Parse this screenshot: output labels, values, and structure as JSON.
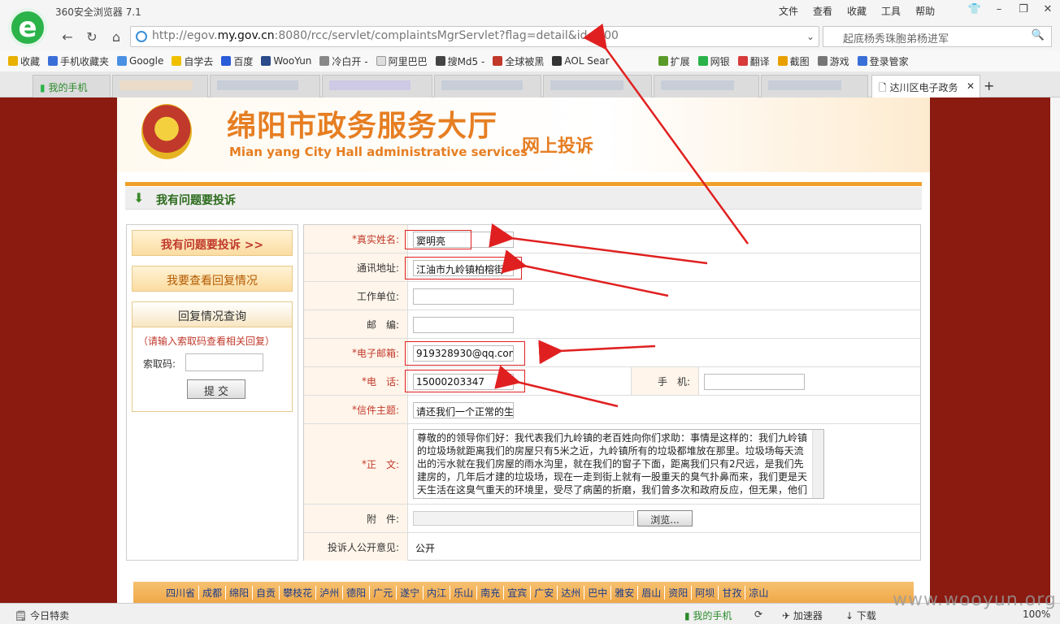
{
  "browser": {
    "title": "360安全浏览器 7.1",
    "menu": [
      "文件",
      "查看",
      "收藏",
      "工具",
      "帮助"
    ],
    "url_prefix": "http://egov.",
    "url_domain": "my.gov.cn",
    "url_suffix": ":8080/rcc/servlet/complaintsMgrServlet?flag=detail&id=800",
    "search_text": "起底杨秀珠胞弟杨进军",
    "bookmarks": [
      "收藏",
      "手机收藏夹",
      "Google",
      "自学去",
      "百度",
      "WooYun",
      "冷白开 -",
      "阿里巴巴",
      "搜Md5 -",
      "全球被黑",
      "AOL Sear",
      "扩展",
      "网银",
      "翻译",
      "截图",
      "游戏",
      "登录管家"
    ],
    "tabs": [
      "我的手机",
      "达川区电子政务"
    ],
    "status_left": "今日特卖",
    "status_items": [
      "我的手机",
      "加速器",
      "下载"
    ],
    "zoom": "100%",
    "watermark": "www.wooyun.org"
  },
  "site": {
    "title_cn": "绵阳市政务服务大厅",
    "title_en": "Mian yang City Hall administrative services",
    "subtitle": "网上投诉",
    "section": "我有问题要投诉"
  },
  "sidebar": {
    "btn1": "我有问题要投诉 >>",
    "btn2": "我要查看回复情况",
    "btn3": "回复情况查询",
    "hint": "（请输入索取码查看相关回复）",
    "code_label": "索取码:",
    "submit": "提 交"
  },
  "form": {
    "name_label": "真实姓名:",
    "name_value": "窦明亮",
    "address_label": "通讯地址:",
    "address_value": "江油市九岭镇柏榕街",
    "work_label": "工作单位:",
    "postcode_label": "邮　编:",
    "email_label": "电子邮箱:",
    "email_value": "919328930@qq.com",
    "phone_label": "电　话:",
    "phone_value": "15000203347",
    "mobile_label": "手　机:",
    "subject_label": "信件主题:",
    "subject_value": "请还我们一个正常的生",
    "body_label": "正　文:",
    "body_value": "尊敬的的领导你们好：我代表我们九岭镇的老百姓向你们求助：事情是这样的：我们九岭镇的垃圾场就距离我们的房屋只有5米之近，九岭镇所有的垃圾都堆放在那里。垃圾场每天流出的污水就在我们房屋的雨水沟里，就在我们的窗子下面，距离我们只有2尺远，是我们先建房的，几年后才建的垃圾场，现在一走到街上就有一股重天的臭气扑鼻而来，我们更是天天生活在这臭气重天的环境里，受尽了病菌的折磨，我们曾多次和政府反应，但无果，他们给出的",
    "attach_label": "附　件:",
    "browse": "浏览...",
    "public_label": "投诉人公开意见:",
    "public_value": "公开"
  },
  "regions": [
    "四川省",
    "成都",
    "绵阳",
    "自贡",
    "攀枝花",
    "泸州",
    "德阳",
    "广元",
    "遂宁",
    "内江",
    "乐山",
    "南充",
    "宜宾",
    "广安",
    "达州",
    "巴中",
    "雅安",
    "眉山",
    "资阳",
    "阿坝",
    "甘孜",
    "凉山"
  ]
}
